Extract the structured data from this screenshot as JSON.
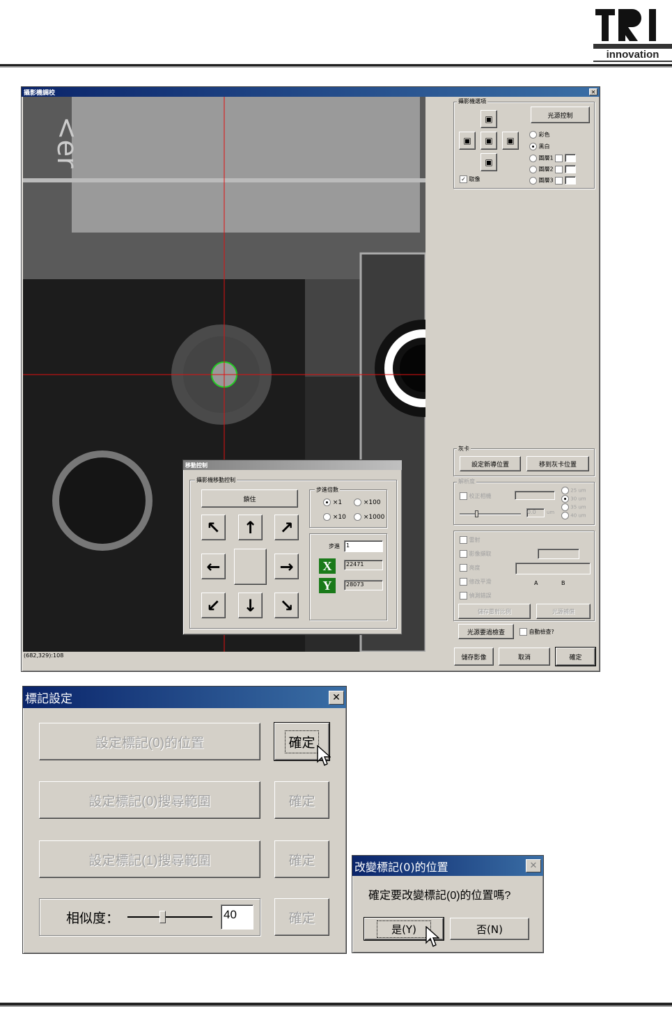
{
  "logo": {
    "letters": "TRI",
    "tagline": "innovation"
  },
  "calib_window": {
    "title": "攝影機調校",
    "status": "(682,329):108",
    "camera_options": {
      "title": "攝影機選項",
      "light_button": "光源控制",
      "overlay_label": "取像",
      "color_modes": [
        "彩色",
        "黑白",
        "圖層1",
        "圖層2",
        "圖層3"
      ],
      "selected_mode": "黑白"
    },
    "gray_card": {
      "title": "灰卡",
      "set_button": "設定新導位置",
      "move_button": "移到灰卡位置"
    },
    "resolution": {
      "title": "解析度",
      "check_label": "校正相機",
      "field_value": "0.0",
      "unit": "um",
      "options": [
        "25 um",
        "30 um",
        "35 um",
        "40 um"
      ]
    },
    "options_group": {
      "checks": [
        "雷射",
        "影像擷取",
        "亮度",
        "修改平滑",
        "偵測錯誤"
      ],
      "label_a": "A",
      "label_b": "B",
      "save_disabled": "儲存雷射比例",
      "light_disabled": "光源補償"
    },
    "light_check_button": "光源要過檢查",
    "auto_check_label": "自動檢查?",
    "save_image_button": "儲存影像",
    "cancel_button": "取消",
    "ok_button": "確定"
  },
  "move_dialog": {
    "title": "移動控制",
    "group_title": "攝影機移動控制",
    "lock_button": "鎖住",
    "step_group_title": "步進倍數",
    "step_options": [
      "×1",
      "×100",
      "×10",
      "×1000"
    ],
    "selected_step": "×1",
    "step_label": "步進",
    "step_value": "1",
    "x_label": "X",
    "x_value": "22471",
    "y_label": "Y",
    "y_value": "28073",
    "arrows": [
      "↖",
      "↑",
      "↗",
      "←",
      "",
      "→",
      "↙",
      "↓",
      "↘"
    ]
  },
  "mark_dialog": {
    "title": "標記設定",
    "rows": [
      {
        "label": "設定標記(0)的位置",
        "ok": "確定"
      },
      {
        "label": "設定標記(0)搜尋範圍",
        "ok": "確定"
      },
      {
        "label": "設定標記(1)搜尋範圍",
        "ok": "確定"
      }
    ],
    "similarity_label": "相似度：",
    "similarity_value": "40",
    "similarity_ok": "確定"
  },
  "confirm_dialog": {
    "title": "改變標記(0)的位置",
    "message": "確定要改變標記(0)的位置嗎?",
    "yes_button": "是(Y)",
    "no_button": "否(N)"
  }
}
